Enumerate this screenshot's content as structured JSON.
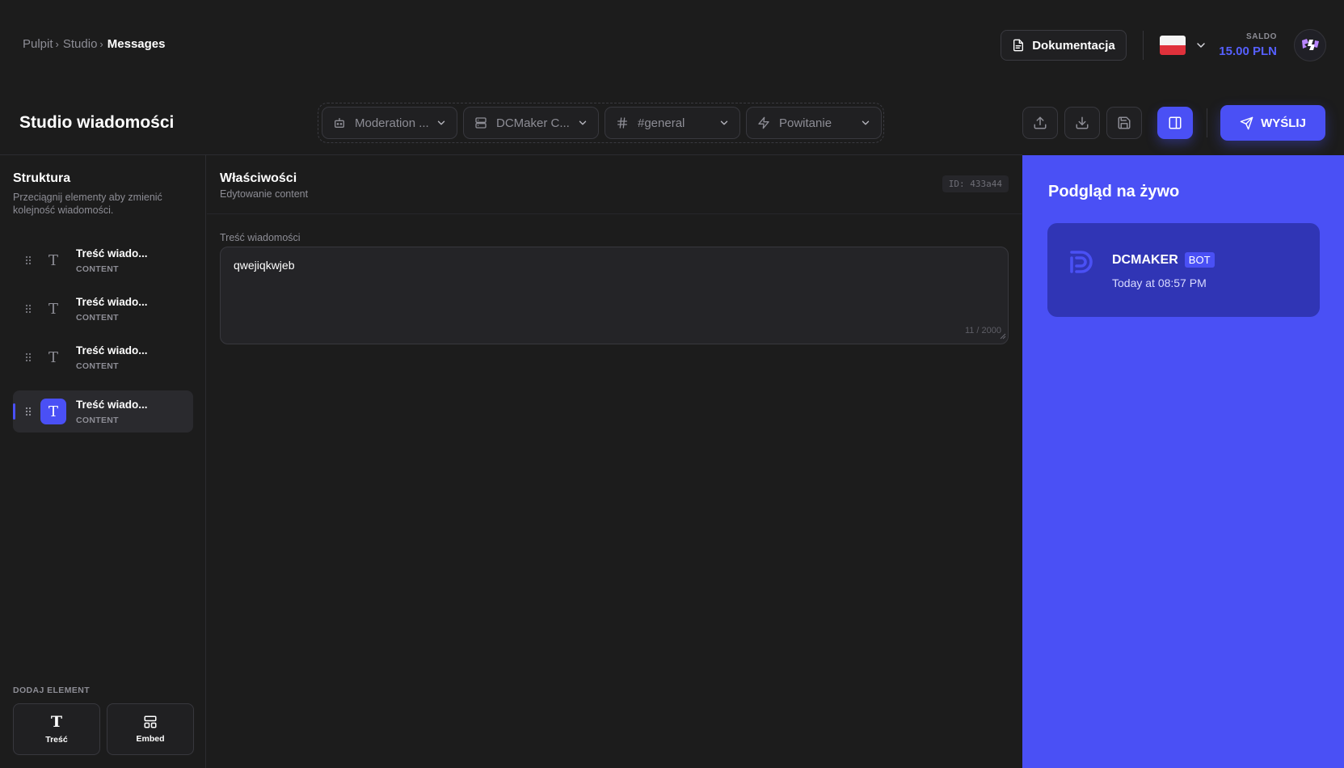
{
  "breadcrumb": {
    "items": [
      "Pulpit",
      "Studio"
    ],
    "current": "Messages"
  },
  "header": {
    "docs_label": "Dokumentacja",
    "saldo_label": "SALDO",
    "saldo_value": "15.00 PLN",
    "page_title": "Studio wiadomości",
    "send_label": "WYŚLIJ"
  },
  "selectors": {
    "bot": "Moderation ...",
    "server": "DCMaker C...",
    "channel": "#general",
    "template": "Powitanie"
  },
  "sidebar": {
    "title": "Struktura",
    "description": "Przeciągnij elementy aby zmienić kolejność wiadomości.",
    "items": [
      {
        "name": "Treść wiado...",
        "kind": "CONTENT"
      },
      {
        "name": "Treść wiado...",
        "kind": "CONTENT"
      },
      {
        "name": "Treść wiado...",
        "kind": "CONTENT"
      },
      {
        "name": "Treść wiado...",
        "kind": "CONTENT"
      }
    ],
    "add_label": "DODAJ ELEMENT",
    "add_text_label": "Treść",
    "add_embed_label": "Embed"
  },
  "properties": {
    "title": "Właściwości",
    "subtitle": "Edytowanie content",
    "id": "ID: 433a44",
    "field_label": "Treść wiadomości",
    "field_value": "qwejiqkwjeb",
    "counter": "11 / 2000"
  },
  "preview": {
    "title": "Podgląd na żywo",
    "author": "DCMAKER",
    "badge": "BOT",
    "timestamp": "Today at 08:57 PM"
  },
  "colors": {
    "accent": "#4a50f5",
    "background": "#1c1c1c",
    "saldo": "#5660ff",
    "preview_card": "#3035b5"
  }
}
